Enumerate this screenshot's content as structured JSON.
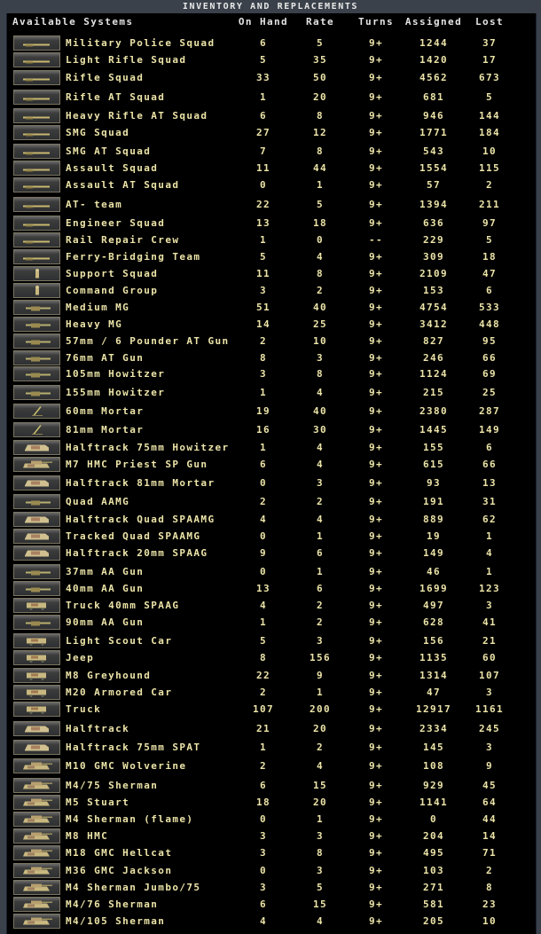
{
  "window": {
    "title": "INVENTORY AND REPLACEMENTS"
  },
  "columns": {
    "name": "Available Systems",
    "on_hand": "On Hand",
    "rate": "Rate",
    "turns": "Turns",
    "assigned": "Assigned",
    "lost": "Lost"
  },
  "colors": {
    "text": "#ece4a8",
    "header": "#e4e4e4",
    "background": "#000000",
    "frame": "#3a414a"
  },
  "rows": [
    {
      "name": "Military Police Squad",
      "on_hand": "6",
      "rate": "5",
      "turns": "9+",
      "assigned": "1244",
      "lost": "37",
      "icon": "rifle"
    },
    {
      "name": "Light Rifle Squad",
      "on_hand": "5",
      "rate": "35",
      "turns": "9+",
      "assigned": "1420",
      "lost": "17",
      "icon": "rifle"
    },
    {
      "name": "Rifle Squad",
      "on_hand": "33",
      "rate": "50",
      "turns": "9+",
      "assigned": "4562",
      "lost": "673",
      "icon": "rifle"
    },
    {
      "name": "Rifle AT Squad",
      "on_hand": "1",
      "rate": "20",
      "turns": "9+",
      "assigned": "681",
      "lost": "5",
      "icon": "rifle"
    },
    {
      "name": "Heavy Rifle AT Squad",
      "on_hand": "6",
      "rate": "8",
      "turns": "9+",
      "assigned": "946",
      "lost": "144",
      "icon": "rifle"
    },
    {
      "name": "SMG Squad",
      "on_hand": "27",
      "rate": "12",
      "turns": "9+",
      "assigned": "1771",
      "lost": "184",
      "icon": "rifle"
    },
    {
      "name": "SMG AT Squad",
      "on_hand": "7",
      "rate": "8",
      "turns": "9+",
      "assigned": "543",
      "lost": "10",
      "icon": "rifle"
    },
    {
      "name": "Assault Squad",
      "on_hand": "11",
      "rate": "44",
      "turns": "9+",
      "assigned": "1554",
      "lost": "115",
      "icon": "rifle"
    },
    {
      "name": "Assault AT Squad",
      "on_hand": "0",
      "rate": "1",
      "turns": "9+",
      "assigned": "57",
      "lost": "2",
      "icon": "rifle"
    },
    {
      "name": "AT- team",
      "on_hand": "22",
      "rate": "5",
      "turns": "9+",
      "assigned": "1394",
      "lost": "211",
      "icon": "rifle"
    },
    {
      "name": "Engineer Squad",
      "on_hand": "13",
      "rate": "18",
      "turns": "9+",
      "assigned": "636",
      "lost": "97",
      "icon": "rifle"
    },
    {
      "name": "Rail Repair Crew",
      "on_hand": "1",
      "rate": "0",
      "turns": "--",
      "assigned": "229",
      "lost": "5",
      "icon": "rifle"
    },
    {
      "name": "Ferry-Bridging Team",
      "on_hand": "5",
      "rate": "4",
      "turns": "9+",
      "assigned": "309",
      "lost": "18",
      "icon": "rifle"
    },
    {
      "name": "Support Squad",
      "on_hand": "11",
      "rate": "8",
      "turns": "9+",
      "assigned": "2109",
      "lost": "47",
      "icon": "soldier"
    },
    {
      "name": "Command Group",
      "on_hand": "3",
      "rate": "2",
      "turns": "9+",
      "assigned": "153",
      "lost": "6",
      "icon": "soldier"
    },
    {
      "name": "Medium MG",
      "on_hand": "51",
      "rate": "40",
      "turns": "9+",
      "assigned": "4754",
      "lost": "533",
      "icon": "gun"
    },
    {
      "name": "Heavy MG",
      "on_hand": "14",
      "rate": "25",
      "turns": "9+",
      "assigned": "3412",
      "lost": "448",
      "icon": "gun"
    },
    {
      "name": "57mm / 6 Pounder AT Gun",
      "on_hand": "2",
      "rate": "10",
      "turns": "9+",
      "assigned": "827",
      "lost": "95",
      "icon": "gun"
    },
    {
      "name": "76mm AT Gun",
      "on_hand": "8",
      "rate": "3",
      "turns": "9+",
      "assigned": "246",
      "lost": "66",
      "icon": "gun"
    },
    {
      "name": "105mm Howitzer",
      "on_hand": "3",
      "rate": "8",
      "turns": "9+",
      "assigned": "1124",
      "lost": "69",
      "icon": "gun"
    },
    {
      "name": "155mm Howitzer",
      "on_hand": "1",
      "rate": "4",
      "turns": "9+",
      "assigned": "215",
      "lost": "25",
      "icon": "gun"
    },
    {
      "name": "60mm Mortar",
      "on_hand": "19",
      "rate": "40",
      "turns": "9+",
      "assigned": "2380",
      "lost": "287",
      "icon": "mortar"
    },
    {
      "name": "81mm Mortar",
      "on_hand": "16",
      "rate": "30",
      "turns": "9+",
      "assigned": "1445",
      "lost": "149",
      "icon": "mortar"
    },
    {
      "name": "Halftrack 75mm Howitzer",
      "on_hand": "1",
      "rate": "4",
      "turns": "9+",
      "assigned": "155",
      "lost": "6",
      "icon": "halftrack"
    },
    {
      "name": "M7 HMC Priest SP Gun",
      "on_hand": "6",
      "rate": "4",
      "turns": "9+",
      "assigned": "615",
      "lost": "66",
      "icon": "tank"
    },
    {
      "name": "Halftrack 81mm Mortar",
      "on_hand": "0",
      "rate": "3",
      "turns": "9+",
      "assigned": "93",
      "lost": "13",
      "icon": "halftrack"
    },
    {
      "name": "Quad AAMG",
      "on_hand": "2",
      "rate": "2",
      "turns": "9+",
      "assigned": "191",
      "lost": "31",
      "icon": "gun"
    },
    {
      "name": "Halftrack Quad SPAAMG",
      "on_hand": "4",
      "rate": "4",
      "turns": "9+",
      "assigned": "889",
      "lost": "62",
      "icon": "halftrack"
    },
    {
      "name": "Tracked Quad SPAAMG",
      "on_hand": "0",
      "rate": "1",
      "turns": "9+",
      "assigned": "19",
      "lost": "1",
      "icon": "halftrack"
    },
    {
      "name": "Halftrack 20mm SPAAG",
      "on_hand": "9",
      "rate": "6",
      "turns": "9+",
      "assigned": "149",
      "lost": "4",
      "icon": "halftrack"
    },
    {
      "name": "37mm AA Gun",
      "on_hand": "0",
      "rate": "1",
      "turns": "9+",
      "assigned": "46",
      "lost": "1",
      "icon": "gun"
    },
    {
      "name": "40mm AA Gun",
      "on_hand": "13",
      "rate": "6",
      "turns": "9+",
      "assigned": "1699",
      "lost": "123",
      "icon": "gun"
    },
    {
      "name": "Truck 40mm SPAAG",
      "on_hand": "4",
      "rate": "2",
      "turns": "9+",
      "assigned": "497",
      "lost": "3",
      "icon": "truck"
    },
    {
      "name": "90mm AA Gun",
      "on_hand": "1",
      "rate": "2",
      "turns": "9+",
      "assigned": "628",
      "lost": "41",
      "icon": "gun"
    },
    {
      "name": "Light Scout Car",
      "on_hand": "5",
      "rate": "3",
      "turns": "9+",
      "assigned": "156",
      "lost": "21",
      "icon": "truck"
    },
    {
      "name": "Jeep",
      "on_hand": "8",
      "rate": "156",
      "turns": "9+",
      "assigned": "1135",
      "lost": "60",
      "icon": "truck"
    },
    {
      "name": "M8 Greyhound",
      "on_hand": "22",
      "rate": "9",
      "turns": "9+",
      "assigned": "1314",
      "lost": "107",
      "icon": "truck"
    },
    {
      "name": "M20 Armored Car",
      "on_hand": "2",
      "rate": "1",
      "turns": "9+",
      "assigned": "47",
      "lost": "3",
      "icon": "truck"
    },
    {
      "name": "Truck",
      "on_hand": "107",
      "rate": "200",
      "turns": "9+",
      "assigned": "12917",
      "lost": "1161",
      "icon": "truck"
    },
    {
      "name": "Halftrack",
      "on_hand": "21",
      "rate": "20",
      "turns": "9+",
      "assigned": "2334",
      "lost": "245",
      "icon": "halftrack"
    },
    {
      "name": "Halftrack 75mm SPAT",
      "on_hand": "1",
      "rate": "2",
      "turns": "9+",
      "assigned": "145",
      "lost": "3",
      "icon": "halftrack"
    },
    {
      "name": "M10 GMC Wolverine",
      "on_hand": "2",
      "rate": "4",
      "turns": "9+",
      "assigned": "108",
      "lost": "9",
      "icon": "tank"
    },
    {
      "name": "M4/75 Sherman",
      "on_hand": "6",
      "rate": "15",
      "turns": "9+",
      "assigned": "929",
      "lost": "45",
      "icon": "tank"
    },
    {
      "name": "M5 Stuart",
      "on_hand": "18",
      "rate": "20",
      "turns": "9+",
      "assigned": "1141",
      "lost": "64",
      "icon": "tank"
    },
    {
      "name": "M4 Sherman (flame)",
      "on_hand": "0",
      "rate": "1",
      "turns": "9+",
      "assigned": "0",
      "lost": "44",
      "icon": "tank"
    },
    {
      "name": "M8 HMC",
      "on_hand": "3",
      "rate": "3",
      "turns": "9+",
      "assigned": "204",
      "lost": "14",
      "icon": "tank"
    },
    {
      "name": "M18 GMC Hellcat",
      "on_hand": "3",
      "rate": "8",
      "turns": "9+",
      "assigned": "495",
      "lost": "71",
      "icon": "tank"
    },
    {
      "name": "M36 GMC Jackson",
      "on_hand": "0",
      "rate": "3",
      "turns": "9+",
      "assigned": "103",
      "lost": "2",
      "icon": "tank"
    },
    {
      "name": "M4 Sherman Jumbo/75",
      "on_hand": "3",
      "rate": "5",
      "turns": "9+",
      "assigned": "271",
      "lost": "8",
      "icon": "tank"
    },
    {
      "name": "M4/76 Sherman",
      "on_hand": "6",
      "rate": "15",
      "turns": "9+",
      "assigned": "581",
      "lost": "23",
      "icon": "tank"
    },
    {
      "name": "M4/105 Sherman",
      "on_hand": "4",
      "rate": "4",
      "turns": "9+",
      "assigned": "205",
      "lost": "10",
      "icon": "tank"
    }
  ]
}
